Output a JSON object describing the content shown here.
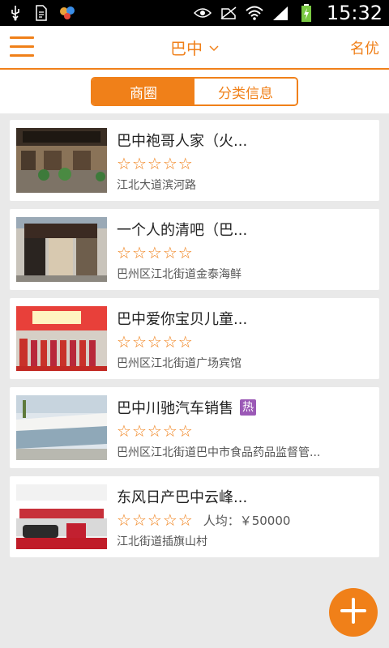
{
  "status_bar": {
    "time": "15:32",
    "icons": [
      "usb-icon",
      "document-icon",
      "app-notification-icon",
      "eye-icon",
      "no-sim-icon",
      "wifi-icon",
      "signal-icon",
      "battery-charging-icon"
    ]
  },
  "header": {
    "city": "巴中",
    "right_link": "名优"
  },
  "tabs": [
    {
      "label": "商圈",
      "active": true
    },
    {
      "label": "分类信息",
      "active": false
    }
  ],
  "listings": [
    {
      "title": "巴中袍哥人家（火...",
      "rating": 0,
      "address": "江北大道滨河路",
      "hot": false,
      "price": ""
    },
    {
      "title": "一个人的清吧（巴...",
      "rating": 0,
      "address": "巴州区江北街道金泰海鲜",
      "hot": false,
      "price": ""
    },
    {
      "title": "巴中爱你宝贝儿童...",
      "rating": 0,
      "address": "巴州区江北街道广场宾馆",
      "hot": false,
      "price": ""
    },
    {
      "title": "巴中川驰汽车销售",
      "rating": 0,
      "address": "巴州区江北街道巴中市食品药品监督管...",
      "hot": true,
      "hot_label": "热",
      "price": ""
    },
    {
      "title": "东风日产巴中云峰...",
      "rating": 0,
      "address": "江北街道插旗山村",
      "hot": false,
      "price": "人均：￥50000"
    }
  ],
  "colors": {
    "accent": "#f08019",
    "hot_badge": "#9b59b6"
  }
}
